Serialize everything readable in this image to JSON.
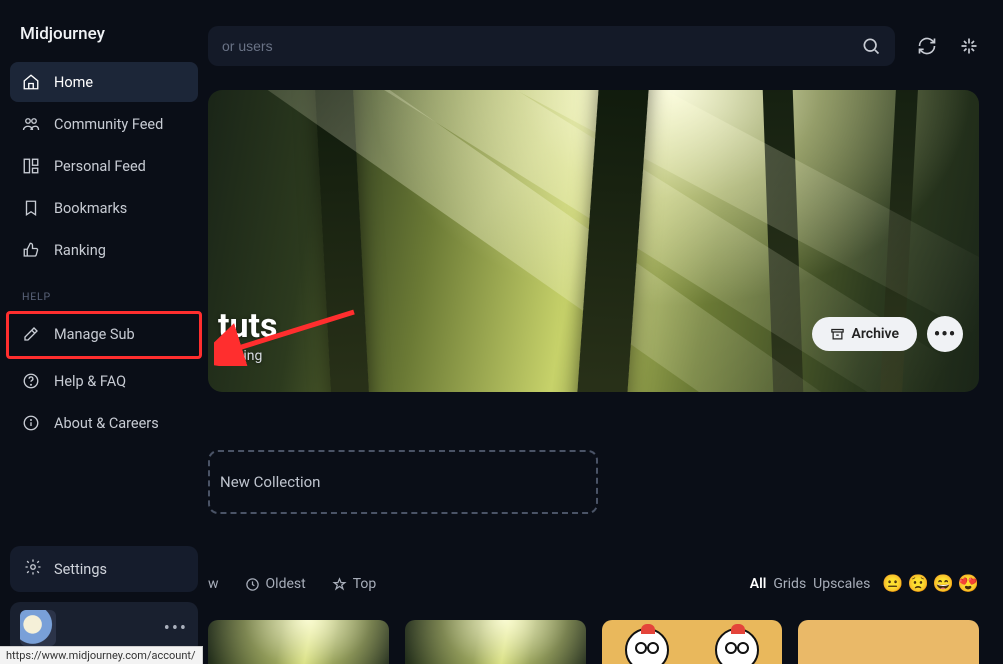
{
  "brand": "Midjourney",
  "nav": {
    "home": "Home",
    "community": "Community Feed",
    "personal": "Personal Feed",
    "bookmarks": "Bookmarks",
    "ranking": "Ranking"
  },
  "help_label": "HELP",
  "help": {
    "manage_sub": "Manage Sub",
    "help_faq": "Help & FAQ",
    "about": "About & Careers"
  },
  "settings_label": "Settings",
  "search": {
    "placeholder": "or users"
  },
  "profile": {
    "name": "tuts",
    "subtitle": "llowing"
  },
  "archive_label": "Archive",
  "new_collection_label": "New Collection",
  "filters": {
    "new_suffix": "w",
    "oldest": "Oldest",
    "top": "Top"
  },
  "views": {
    "all": "All",
    "grids": "Grids",
    "upscales": "Upscales"
  },
  "emoji": [
    "😐",
    "😟",
    "😄",
    "😍"
  ],
  "status_url": "https://www.midjourney.com/account/"
}
